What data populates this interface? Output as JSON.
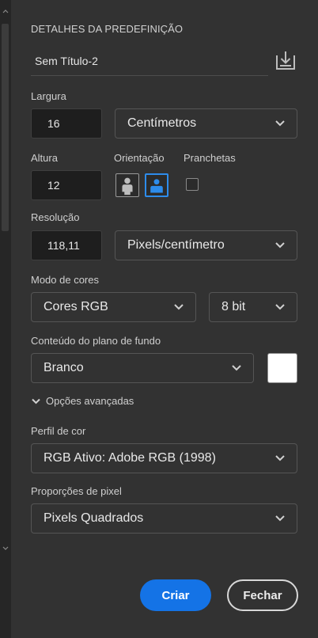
{
  "header": {
    "title": "DETALHES DA PREDEFINIÇÃO",
    "document_name": "Sem Título-2",
    "save_preset_icon": "save-preset-icon"
  },
  "width": {
    "label": "Largura",
    "value": "16",
    "unit": "Centímetros"
  },
  "height": {
    "label": "Altura",
    "value": "12"
  },
  "orientation": {
    "label": "Orientação",
    "selected": "landscape"
  },
  "artboards": {
    "label": "Pranchetas",
    "checked": false
  },
  "resolution": {
    "label": "Resolução",
    "value": "118,11",
    "unit": "Pixels/centímetro"
  },
  "color_mode": {
    "label": "Modo de cores",
    "mode": "Cores RGB",
    "depth": "8 bit"
  },
  "background": {
    "label": "Conteúdo do plano de fundo",
    "value": "Branco",
    "swatch_color": "#ffffff"
  },
  "advanced": {
    "toggle_label": "Opções avançadas",
    "color_profile": {
      "label": "Perfil de cor",
      "value": "RGB Ativo: Adobe RGB (1998)"
    },
    "pixel_aspect": {
      "label": "Proporções de pixel",
      "value": "Pixels Quadrados"
    }
  },
  "actions": {
    "create_label": "Criar",
    "close_label": "Fechar"
  },
  "colors": {
    "accent": "#1473e6",
    "panel_bg": "#323232",
    "input_bg": "#1e1e1e"
  }
}
